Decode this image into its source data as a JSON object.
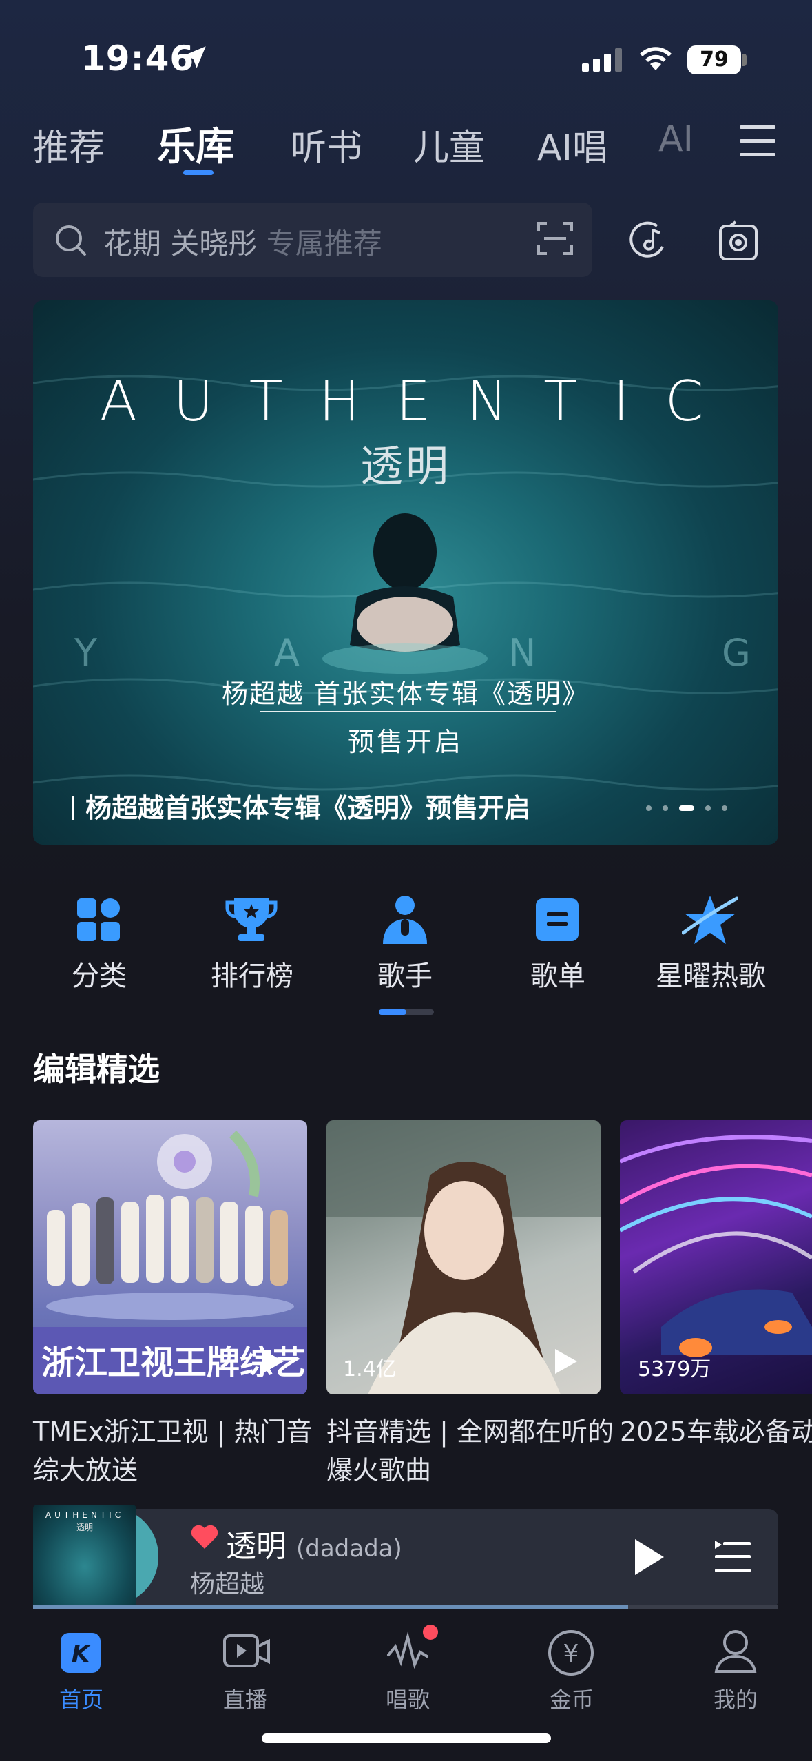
{
  "status_bar": {
    "time": "19:46",
    "battery": "79"
  },
  "tabs": [
    {
      "label": "推荐"
    },
    {
      "label": "乐库",
      "active": true
    },
    {
      "label": "听书"
    },
    {
      "label": "儿童"
    },
    {
      "label": "AI唱"
    },
    {
      "label": "AI"
    }
  ],
  "search": {
    "hint_primary": "花期 关晓彤",
    "hint_secondary": "专属推荐"
  },
  "banner": {
    "title": "AUTHENTIC",
    "title_cn": "透明",
    "letters": [
      "Y",
      "A",
      "N",
      "G"
    ],
    "promo_line1": "杨超越 首张实体专辑《透明》",
    "promo_line2": "预售开启",
    "caption": "杨超越首张实体专辑《透明》预售开启",
    "page_count": 5,
    "active_page": 3
  },
  "quick_nav": [
    {
      "label": "分类",
      "icon": "grid-icon"
    },
    {
      "label": "排行榜",
      "icon": "trophy-icon"
    },
    {
      "label": "歌手",
      "icon": "singer-icon"
    },
    {
      "label": "歌单",
      "icon": "playlist-icon"
    },
    {
      "label": "星曜热歌",
      "icon": "star-icon"
    }
  ],
  "section": {
    "title": "编辑精选",
    "cards": [
      {
        "overlay": "浙江卫视王牌综艺",
        "count": "",
        "title": "TMEx浙江卫视 | 热门音综大放送"
      },
      {
        "overlay": "",
        "count": "1.4亿",
        "title": "抖音精选 | 全网都在听的爆火歌曲"
      },
      {
        "overlay": "",
        "count": "5379万",
        "title": "2025车载必备动"
      }
    ]
  },
  "player": {
    "cover_title": "AUTHENTIC",
    "cover_subtitle": "透明",
    "song": "透明",
    "song_suffix": "(dadada)",
    "artist": "杨超越",
    "progress": 0.8
  },
  "bottom_nav": [
    {
      "label": "首页",
      "active": true
    },
    {
      "label": "直播"
    },
    {
      "label": "唱歌"
    },
    {
      "label": "金币"
    },
    {
      "label": "我的"
    }
  ],
  "colors": {
    "accent": "#3a8cff",
    "background": "#16171f",
    "badge": "#ff4d5e"
  }
}
